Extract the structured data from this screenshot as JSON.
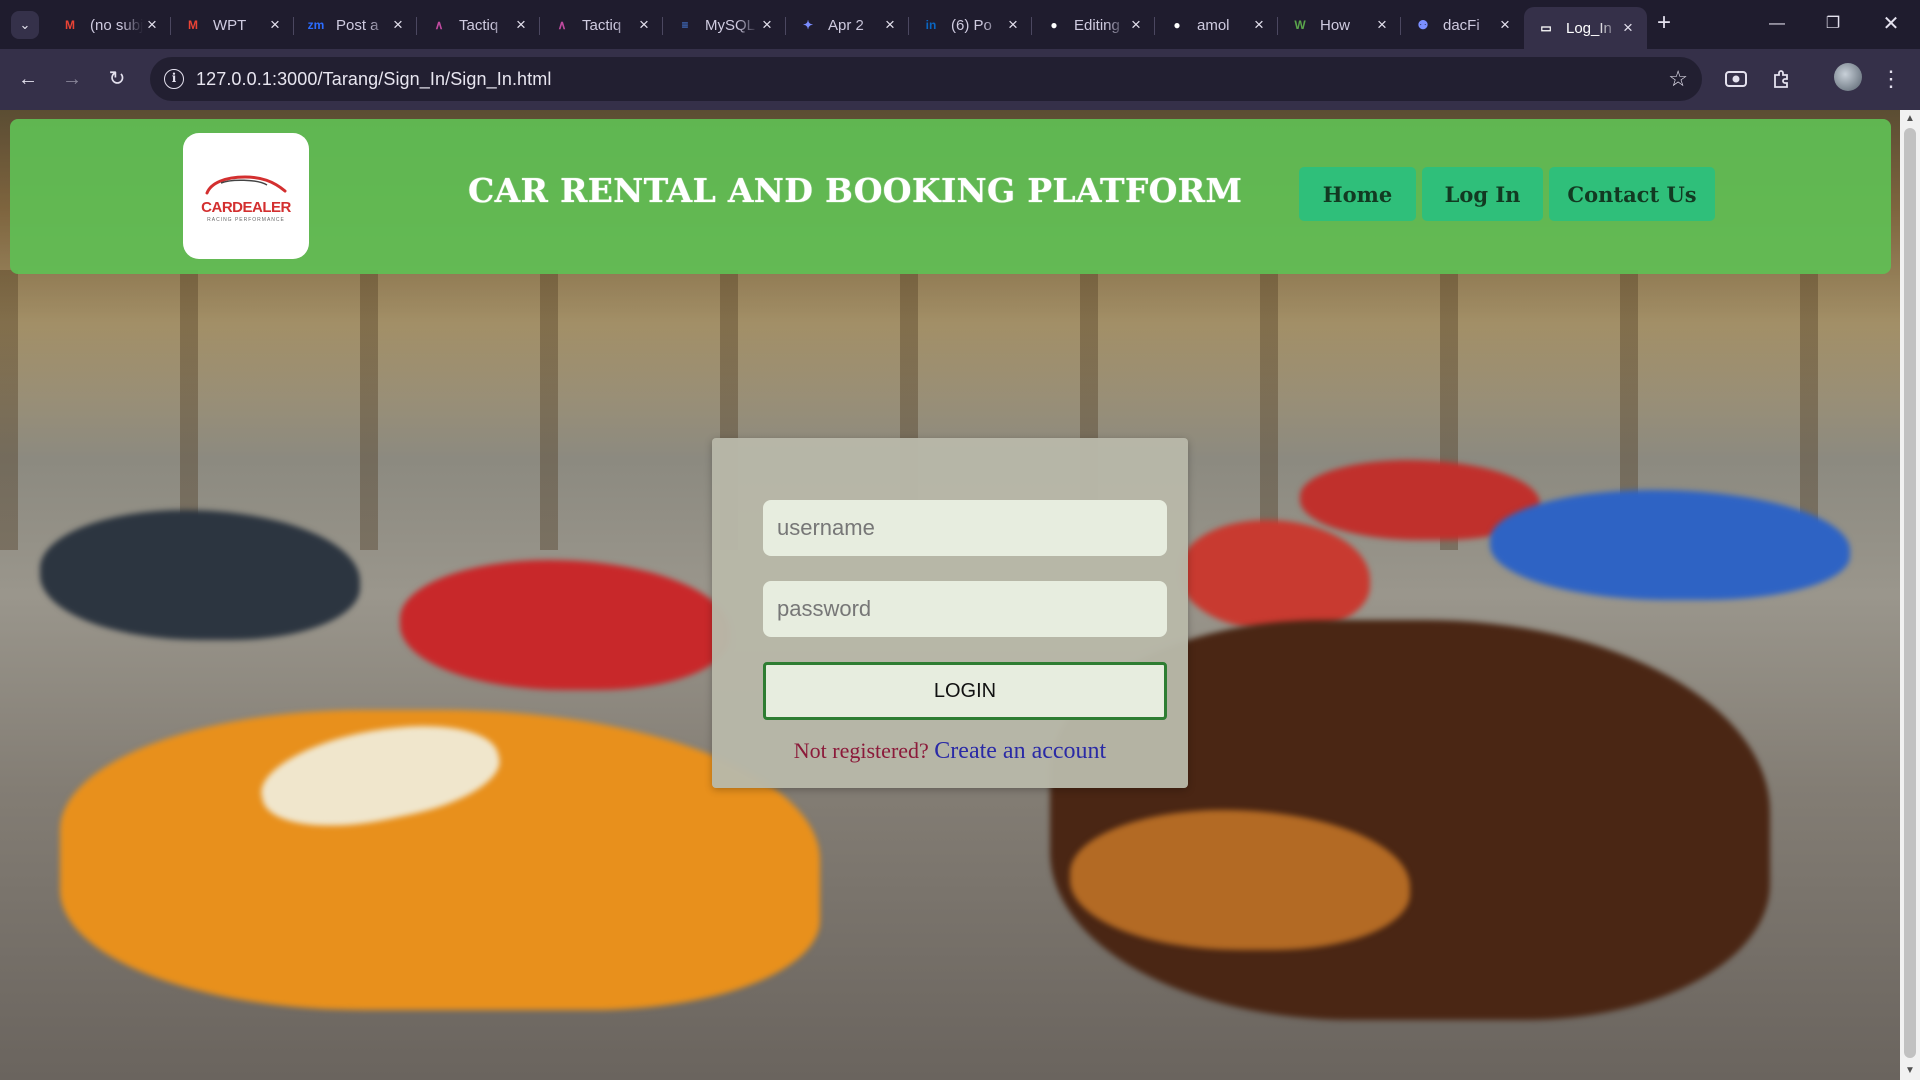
{
  "browser": {
    "tabs": [
      {
        "title": "(no subject)",
        "icon": "gmail-icon",
        "color": "#ea4335",
        "glyph": "M"
      },
      {
        "title": "WPT",
        "icon": "gmail-icon",
        "color": "#ea4335",
        "glyph": "M"
      },
      {
        "title": "Post a",
        "icon": "zoominfo-icon",
        "color": "#2b6cff",
        "glyph": "zm"
      },
      {
        "title": "Tactiq",
        "icon": "tactiq-icon",
        "color": "#c04aa0",
        "glyph": "∧"
      },
      {
        "title": "Tactiq",
        "icon": "tactiq-icon",
        "color": "#c04aa0",
        "glyph": "∧"
      },
      {
        "title": "MySQL",
        "icon": "docs-icon",
        "color": "#4c8bf5",
        "glyph": "≡"
      },
      {
        "title": "Apr 2",
        "icon": "sparkle-icon",
        "color": "#7a8cff",
        "glyph": "✦"
      },
      {
        "title": "(6) Po",
        "icon": "linkedin-icon",
        "color": "#0a66c2",
        "glyph": "in"
      },
      {
        "title": "Editing",
        "icon": "github-icon",
        "color": "#ffffff",
        "glyph": "●"
      },
      {
        "title": "amol",
        "icon": "github-icon",
        "color": "#ffffff",
        "glyph": "●"
      },
      {
        "title": "How",
        "icon": "wikihow-icon",
        "color": "#5aa54b",
        "glyph": "W"
      },
      {
        "title": "dacFi",
        "icon": "people-icon",
        "color": "#7b8fff",
        "glyph": "⚉"
      },
      {
        "title": "Log_In",
        "icon": "page-icon",
        "color": "#ffffff",
        "glyph": "▭",
        "active": true
      }
    ],
    "url": "127.0.0.1:3000/Tarang/Sign_In/Sign_In.html"
  },
  "site": {
    "logo_text": "CARDEALER",
    "logo_sub": "RACING PERFORMANCE",
    "title": "CAR RENTAL AND BOOKING PLATFORM",
    "nav": {
      "home": "Home",
      "login": "Log In",
      "contact": "Contact Us"
    }
  },
  "login": {
    "username_placeholder": "username",
    "password_placeholder": "password",
    "button_label": "LOGIN",
    "register_question": "Not registered?",
    "register_link": "Create an account"
  },
  "colors": {
    "header_green": "#60be54",
    "nav_button": "#2fbf7a",
    "card": "#b8b8a8",
    "login_border": "#2e7d32"
  }
}
